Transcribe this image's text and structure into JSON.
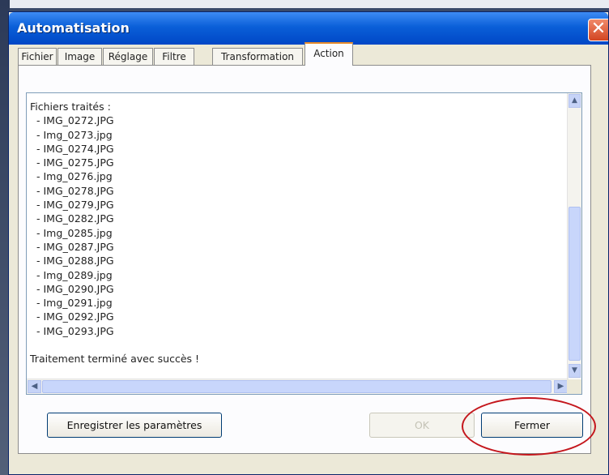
{
  "window": {
    "title": "Automatisation",
    "close_symbol": "✕"
  },
  "tabs": [
    {
      "label": "Fichier",
      "active": false
    },
    {
      "label": "Image",
      "active": false
    },
    {
      "label": "Réglage",
      "active": false
    },
    {
      "label": "Filtre",
      "active": false
    },
    {
      "label": "Transformation",
      "active": false
    },
    {
      "label": "Action",
      "active": true
    }
  ],
  "log": {
    "header": "Fichiers traités :",
    "files": [
      "- IMG_0272.JPG",
      "- Img_0273.jpg",
      "- IMG_0274.JPG",
      "- IMG_0275.JPG",
      "- Img_0276.jpg",
      "- IMG_0278.JPG",
      "- IMG_0279.JPG",
      "- IMG_0282.JPG",
      "- Img_0285.jpg",
      "- IMG_0287.JPG",
      "- IMG_0288.JPG",
      "- Img_0289.jpg",
      "- IMG_0290.JPG",
      "- Img_0291.jpg",
      "- IMG_0292.JPG",
      "- IMG_0293.JPG"
    ],
    "footer": "Traitement terminé avec succès !"
  },
  "buttons": {
    "save": "Enregistrer les paramètres",
    "ok": "OK",
    "close": "Fermer"
  },
  "scroll_icons": {
    "up": "▲",
    "down": "▼",
    "left": "◀",
    "right": "▶"
  },
  "colors": {
    "titlebar": "#0a5fd8",
    "highlight_circle": "#c4161c",
    "active_tab_accent": "#e68b2c"
  }
}
